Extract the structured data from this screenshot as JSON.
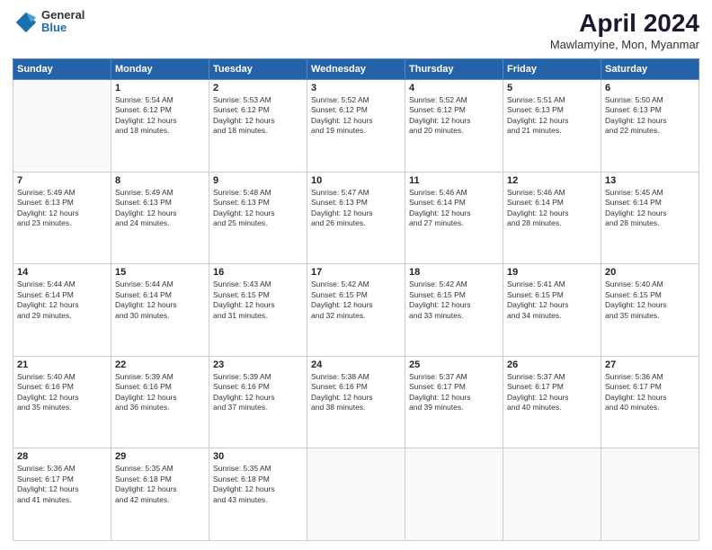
{
  "logo": {
    "line1": "General",
    "line2": "Blue"
  },
  "title": "April 2024",
  "subtitle": "Mawlamyine, Mon, Myanmar",
  "days_of_week": [
    "Sunday",
    "Monday",
    "Tuesday",
    "Wednesday",
    "Thursday",
    "Friday",
    "Saturday"
  ],
  "weeks": [
    [
      {
        "day": "",
        "info": ""
      },
      {
        "day": "1",
        "info": "Sunrise: 5:54 AM\nSunset: 6:12 PM\nDaylight: 12 hours\nand 18 minutes."
      },
      {
        "day": "2",
        "info": "Sunrise: 5:53 AM\nSunset: 6:12 PM\nDaylight: 12 hours\nand 18 minutes."
      },
      {
        "day": "3",
        "info": "Sunrise: 5:52 AM\nSunset: 6:12 PM\nDaylight: 12 hours\nand 19 minutes."
      },
      {
        "day": "4",
        "info": "Sunrise: 5:52 AM\nSunset: 6:12 PM\nDaylight: 12 hours\nand 20 minutes."
      },
      {
        "day": "5",
        "info": "Sunrise: 5:51 AM\nSunset: 6:13 PM\nDaylight: 12 hours\nand 21 minutes."
      },
      {
        "day": "6",
        "info": "Sunrise: 5:50 AM\nSunset: 6:13 PM\nDaylight: 12 hours\nand 22 minutes."
      }
    ],
    [
      {
        "day": "7",
        "info": "Sunrise: 5:49 AM\nSunset: 6:13 PM\nDaylight: 12 hours\nand 23 minutes."
      },
      {
        "day": "8",
        "info": "Sunrise: 5:49 AM\nSunset: 6:13 PM\nDaylight: 12 hours\nand 24 minutes."
      },
      {
        "day": "9",
        "info": "Sunrise: 5:48 AM\nSunset: 6:13 PM\nDaylight: 12 hours\nand 25 minutes."
      },
      {
        "day": "10",
        "info": "Sunrise: 5:47 AM\nSunset: 6:13 PM\nDaylight: 12 hours\nand 26 minutes."
      },
      {
        "day": "11",
        "info": "Sunrise: 5:46 AM\nSunset: 6:14 PM\nDaylight: 12 hours\nand 27 minutes."
      },
      {
        "day": "12",
        "info": "Sunrise: 5:46 AM\nSunset: 6:14 PM\nDaylight: 12 hours\nand 28 minutes."
      },
      {
        "day": "13",
        "info": "Sunrise: 5:45 AM\nSunset: 6:14 PM\nDaylight: 12 hours\nand 28 minutes."
      }
    ],
    [
      {
        "day": "14",
        "info": "Sunrise: 5:44 AM\nSunset: 6:14 PM\nDaylight: 12 hours\nand 29 minutes."
      },
      {
        "day": "15",
        "info": "Sunrise: 5:44 AM\nSunset: 6:14 PM\nDaylight: 12 hours\nand 30 minutes."
      },
      {
        "day": "16",
        "info": "Sunrise: 5:43 AM\nSunset: 6:15 PM\nDaylight: 12 hours\nand 31 minutes."
      },
      {
        "day": "17",
        "info": "Sunrise: 5:42 AM\nSunset: 6:15 PM\nDaylight: 12 hours\nand 32 minutes."
      },
      {
        "day": "18",
        "info": "Sunrise: 5:42 AM\nSunset: 6:15 PM\nDaylight: 12 hours\nand 33 minutes."
      },
      {
        "day": "19",
        "info": "Sunrise: 5:41 AM\nSunset: 6:15 PM\nDaylight: 12 hours\nand 34 minutes."
      },
      {
        "day": "20",
        "info": "Sunrise: 5:40 AM\nSunset: 6:15 PM\nDaylight: 12 hours\nand 35 minutes."
      }
    ],
    [
      {
        "day": "21",
        "info": "Sunrise: 5:40 AM\nSunset: 6:16 PM\nDaylight: 12 hours\nand 35 minutes."
      },
      {
        "day": "22",
        "info": "Sunrise: 5:39 AM\nSunset: 6:16 PM\nDaylight: 12 hours\nand 36 minutes."
      },
      {
        "day": "23",
        "info": "Sunrise: 5:39 AM\nSunset: 6:16 PM\nDaylight: 12 hours\nand 37 minutes."
      },
      {
        "day": "24",
        "info": "Sunrise: 5:38 AM\nSunset: 6:16 PM\nDaylight: 12 hours\nand 38 minutes."
      },
      {
        "day": "25",
        "info": "Sunrise: 5:37 AM\nSunset: 6:17 PM\nDaylight: 12 hours\nand 39 minutes."
      },
      {
        "day": "26",
        "info": "Sunrise: 5:37 AM\nSunset: 6:17 PM\nDaylight: 12 hours\nand 40 minutes."
      },
      {
        "day": "27",
        "info": "Sunrise: 5:36 AM\nSunset: 6:17 PM\nDaylight: 12 hours\nand 40 minutes."
      }
    ],
    [
      {
        "day": "28",
        "info": "Sunrise: 5:36 AM\nSunset: 6:17 PM\nDaylight: 12 hours\nand 41 minutes."
      },
      {
        "day": "29",
        "info": "Sunrise: 5:35 AM\nSunset: 6:18 PM\nDaylight: 12 hours\nand 42 minutes."
      },
      {
        "day": "30",
        "info": "Sunrise: 5:35 AM\nSunset: 6:18 PM\nDaylight: 12 hours\nand 43 minutes."
      },
      {
        "day": "",
        "info": ""
      },
      {
        "day": "",
        "info": ""
      },
      {
        "day": "",
        "info": ""
      },
      {
        "day": "",
        "info": ""
      }
    ]
  ]
}
